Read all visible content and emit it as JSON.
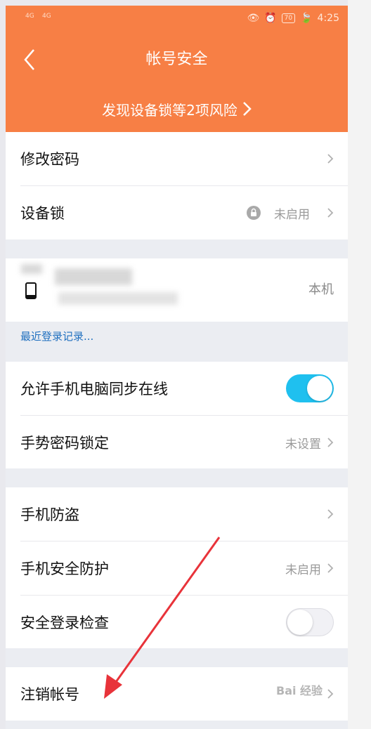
{
  "status_bar": {
    "signal_1": "4G",
    "signal_2": "4G",
    "battery": "70",
    "time": "4:25"
  },
  "header": {
    "title": "帐号安全",
    "risk_banner": "发现设备锁等2项风险"
  },
  "security_items": [
    {
      "label": "修改密码"
    },
    {
      "label": "设备锁",
      "value": "未启用"
    }
  ],
  "device": {
    "value": "本机",
    "recent_login_link": "最近登录记录..."
  },
  "sync_settings": [
    {
      "label": "允许手机电脑同步在线",
      "toggle": "on"
    },
    {
      "label": "手势密码锁定",
      "value": "未设置"
    }
  ],
  "protection_items": [
    {
      "label": "手机防盗"
    },
    {
      "label": "手机安全防护",
      "value": "未启用"
    },
    {
      "label": "安全登录检查",
      "toggle": "off"
    }
  ],
  "account": {
    "label": "注销帐号"
  },
  "watermark": "Bai 经验",
  "colors": {
    "header": "#f77f45",
    "toggle_on": "#1fc0ef",
    "link": "#1f6fbf",
    "arrow": "#e8333a"
  }
}
